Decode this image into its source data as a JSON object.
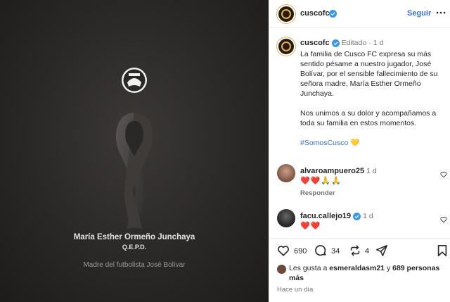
{
  "image": {
    "name": "María Esther Ormeño Junchaya",
    "qepd": "Q.E.P.D.",
    "subtitle": "Madre del futbolista José Bolívar",
    "crest_text": "CUSCO"
  },
  "header": {
    "username": "cuscofc",
    "follow_label": "Seguir"
  },
  "caption": {
    "username": "cuscofc",
    "edited": "Editado",
    "dot": "·",
    "time": "1 d",
    "paragraph1": "La familia de Cusco FC expresa su más sentido pésame a nuestro jugador, José Bolívar, por el sensible fallecimiento de su señora madre, María Esther Ormeño Junchaya.",
    "paragraph2": "Nos unimos a su dolor y acompañamos a toda su familia en estos momentos.",
    "hashtag": "#SomosCusco",
    "emoji": "💛"
  },
  "comments": [
    {
      "username": "alvaroampuero25",
      "time": "1 d",
      "text": "❤️❤️🙏🙏",
      "reply_label": "Responder"
    },
    {
      "username": "facu.callejo19",
      "time": "1 d",
      "text": "❤️❤️"
    }
  ],
  "actions": {
    "likes": "690",
    "comments": "34",
    "reposts": "4"
  },
  "likes_line": {
    "prefix": "Les gusta a ",
    "user": "esmeraldasm21",
    "middle": " y ",
    "others": "689 personas más"
  },
  "timeago": "Hace un día",
  "colors": {
    "accent": "#3b6fd4",
    "verified": "#3897f0",
    "heart": "#ed4956"
  }
}
